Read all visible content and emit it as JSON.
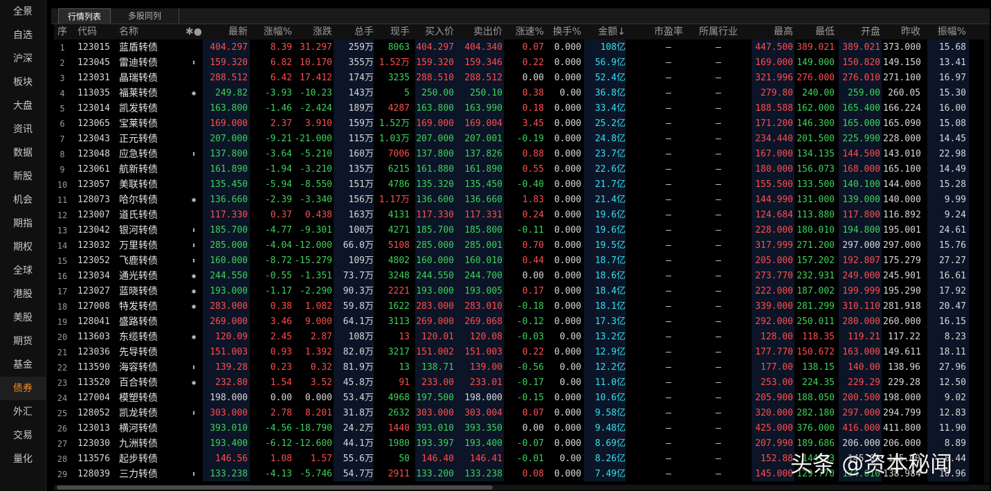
{
  "sidebar": [
    "全景",
    "自选",
    "沪深",
    "板块",
    "大盘",
    "资讯",
    "数据",
    "新股",
    "机会",
    "期指",
    "期权",
    "全球",
    "港股",
    "美股",
    "期货",
    "基金",
    "债券",
    "外汇",
    "交易",
    "量化"
  ],
  "active_sidebar": "债券",
  "tabs": [
    "行情列表",
    "多股同列"
  ],
  "columns": [
    "序",
    "代码",
    "名称",
    "✱●",
    "最新",
    "涨幅%",
    "涨跌",
    "总手",
    "现手",
    "买入价",
    "卖出价",
    "涨速%",
    "换手%",
    "金额↓",
    "市盈率",
    "所属行业",
    "最高",
    "最低",
    "开盘",
    "昨收",
    "振幅%"
  ],
  "colors": {
    "up": "#ff4d4d",
    "down": "#3cd35b",
    "flat": "#d8d8d8",
    "amount": "#33e0f0",
    "active_tab": "#ff8a1e"
  },
  "rows": [
    [
      "1",
      "123015",
      "蓝盾转债",
      "",
      "404.297",
      "8.39",
      "31.297",
      "259万",
      "8063",
      "404.297",
      "404.340",
      "0.07",
      "0.000",
      "108亿",
      "—",
      "—",
      "447.500",
      "389.021",
      "389.021",
      "373.000",
      "15.68"
    ],
    [
      "2",
      "123045",
      "雷迪转债",
      "⬍",
      "159.320",
      "6.82",
      "10.170",
      "355万",
      "1.52万",
      "159.320",
      "159.346",
      "0.22",
      "0.000",
      "56.9亿",
      "—",
      "—",
      "169.000",
      "149.000",
      "150.820",
      "149.150",
      "13.41"
    ],
    [
      "3",
      "123031",
      "晶瑞转债",
      "",
      "288.512",
      "6.42",
      "17.412",
      "174万",
      "3235",
      "288.510",
      "288.512",
      "0.00",
      "0.000",
      "52.4亿",
      "—",
      "—",
      "321.996",
      "276.000",
      "276.010",
      "271.100",
      "16.97"
    ],
    [
      "4",
      "113035",
      "福莱转债",
      "✱",
      "249.82",
      "-3.93",
      "-10.23",
      "143万",
      "5",
      "250.00",
      "250.10",
      "0.38",
      "0.00",
      "36.8亿",
      "—",
      "—",
      "279.80",
      "240.00",
      "259.00",
      "260.05",
      "15.30"
    ],
    [
      "5",
      "123014",
      "凯发转债",
      "",
      "163.800",
      "-1.46",
      "-2.424",
      "189万",
      "4287",
      "163.800",
      "163.990",
      "0.18",
      "0.000",
      "33.4亿",
      "—",
      "—",
      "188.588",
      "162.000",
      "165.400",
      "166.224",
      "16.00"
    ],
    [
      "6",
      "123065",
      "宝莱转债",
      "",
      "169.000",
      "2.37",
      "3.910",
      "159万",
      "1.52万",
      "169.000",
      "169.004",
      "3.45",
      "0.000",
      "25.2亿",
      "—",
      "—",
      "171.200",
      "146.300",
      "165.000",
      "165.090",
      "15.08"
    ],
    [
      "7",
      "123043",
      "正元转债",
      "",
      "207.000",
      "-9.21",
      "-21.000",
      "115万",
      "1.03万",
      "207.000",
      "207.001",
      "-0.19",
      "0.000",
      "24.8亿",
      "—",
      "—",
      "234.440",
      "201.500",
      "225.990",
      "228.000",
      "14.45"
    ],
    [
      "8",
      "123048",
      "应急转债",
      "⬍",
      "137.800",
      "-3.64",
      "-5.210",
      "160万",
      "7006",
      "137.800",
      "137.826",
      "0.88",
      "0.000",
      "23.7亿",
      "—",
      "—",
      "167.000",
      "134.135",
      "144.500",
      "143.010",
      "22.98"
    ],
    [
      "9",
      "123061",
      "航新转债",
      "",
      "161.890",
      "-1.94",
      "-3.210",
      "135万",
      "6215",
      "161.880",
      "161.890",
      "0.55",
      "0.000",
      "22.6亿",
      "—",
      "—",
      "180.000",
      "156.073",
      "168.000",
      "165.100",
      "14.49"
    ],
    [
      "10",
      "123057",
      "美联转债",
      "",
      "135.450",
      "-5.94",
      "-8.550",
      "151万",
      "4786",
      "135.320",
      "135.450",
      "-0.40",
      "0.000",
      "21.7亿",
      "—",
      "—",
      "155.500",
      "133.500",
      "140.100",
      "144.000",
      "15.28"
    ],
    [
      "11",
      "128073",
      "哈尔转债",
      "✱",
      "136.660",
      "-2.39",
      "-3.340",
      "156万",
      "1.17万",
      "136.600",
      "136.660",
      "1.83",
      "0.000",
      "21.4亿",
      "—",
      "—",
      "144.990",
      "131.000",
      "139.000",
      "140.000",
      "9.99"
    ],
    [
      "12",
      "123007",
      "道氏转债",
      "",
      "117.330",
      "0.37",
      "0.438",
      "163万",
      "4131",
      "117.330",
      "117.331",
      "0.24",
      "0.000",
      "19.6亿",
      "—",
      "—",
      "124.684",
      "113.880",
      "117.800",
      "116.892",
      "9.24"
    ],
    [
      "13",
      "123042",
      "银河转债",
      "⬍",
      "185.700",
      "-4.77",
      "-9.301",
      "100万",
      "4271",
      "185.700",
      "185.800",
      "-0.11",
      "0.000",
      "19.6亿",
      "—",
      "—",
      "228.000",
      "180.010",
      "194.800",
      "195.001",
      "24.61"
    ],
    [
      "14",
      "123032",
      "万里转债",
      "⬍",
      "285.000",
      "-4.04",
      "-12.000",
      "66.0万",
      "5108",
      "285.000",
      "285.001",
      "0.70",
      "0.000",
      "19.5亿",
      "—",
      "—",
      "317.999",
      "271.200",
      "297.000",
      "297.000",
      "15.76"
    ],
    [
      "15",
      "123052",
      "飞鹿转债",
      "⬍",
      "160.000",
      "-8.72",
      "-15.279",
      "109万",
      "4802",
      "160.000",
      "160.010",
      "0.44",
      "0.000",
      "18.7亿",
      "—",
      "—",
      "205.000",
      "157.202",
      "192.807",
      "175.279",
      "27.27"
    ],
    [
      "16",
      "123034",
      "通光转债",
      "✱",
      "244.550",
      "-0.55",
      "-1.351",
      "73.7万",
      "3248",
      "244.550",
      "244.700",
      "0.00",
      "0.000",
      "18.6亿",
      "—",
      "—",
      "273.770",
      "232.931",
      "249.000",
      "245.901",
      "16.61"
    ],
    [
      "17",
      "123027",
      "蓝晓转债",
      "✱",
      "193.000",
      "-1.17",
      "-2.290",
      "90.3万",
      "2221",
      "193.000",
      "193.005",
      "0.17",
      "0.000",
      "18.4亿",
      "—",
      "—",
      "222.000",
      "187.002",
      "199.999",
      "195.290",
      "17.92"
    ],
    [
      "18",
      "127008",
      "特发转债",
      "✱",
      "283.000",
      "0.38",
      "1.082",
      "59.8万",
      "1622",
      "283.000",
      "283.010",
      "-0.18",
      "0.000",
      "18.1亿",
      "—",
      "—",
      "339.000",
      "281.299",
      "310.110",
      "281.918",
      "20.47"
    ],
    [
      "19",
      "128041",
      "盛路转债",
      "",
      "269.000",
      "3.46",
      "9.000",
      "64.1万",
      "3113",
      "269.000",
      "269.068",
      "-0.12",
      "0.000",
      "17.3亿",
      "—",
      "—",
      "292.000",
      "250.011",
      "280.000",
      "260.000",
      "16.15"
    ],
    [
      "20",
      "113603",
      "东缆转债",
      "✱",
      "120.09",
      "2.45",
      "2.87",
      "108万",
      "13",
      "120.01",
      "120.08",
      "-0.03",
      "0.00",
      "13.2亿",
      "—",
      "—",
      "128.00",
      "118.35",
      "119.21",
      "117.22",
      "8.23"
    ],
    [
      "21",
      "123036",
      "先导转债",
      "",
      "151.003",
      "0.93",
      "1.392",
      "82.0万",
      "3217",
      "151.002",
      "151.003",
      "0.22",
      "0.000",
      "12.9亿",
      "—",
      "—",
      "177.770",
      "150.672",
      "163.000",
      "149.611",
      "18.11"
    ],
    [
      "22",
      "113590",
      "海容转债",
      "⬍",
      "139.28",
      "0.23",
      "0.32",
      "81.9万",
      "13",
      "138.71",
      "139.00",
      "-0.56",
      "0.00",
      "12.2亿",
      "—",
      "—",
      "177.00",
      "138.15",
      "140.00",
      "138.96",
      "27.96"
    ],
    [
      "23",
      "113520",
      "百合转债",
      "✱",
      "232.80",
      "1.54",
      "3.52",
      "45.8万",
      "91",
      "233.00",
      "233.01",
      "-0.17",
      "0.00",
      "11.0亿",
      "—",
      "—",
      "253.00",
      "224.35",
      "229.29",
      "229.28",
      "12.50"
    ],
    [
      "24",
      "127004",
      "模塑转债",
      "",
      "198.000",
      "0.00",
      "0.000",
      "53.4万",
      "4968",
      "197.500",
      "198.000",
      "-0.15",
      "0.000",
      "10.6亿",
      "—",
      "—",
      "205.900",
      "188.050",
      "200.500",
      "198.000",
      "9.02"
    ],
    [
      "25",
      "128052",
      "凯龙转债",
      "⬍",
      "303.000",
      "2.78",
      "8.201",
      "31.8万",
      "2632",
      "303.000",
      "303.004",
      "0.07",
      "0.000",
      "9.58亿",
      "—",
      "—",
      "320.000",
      "282.180",
      "297.000",
      "294.799",
      "12.83"
    ],
    [
      "26",
      "123013",
      "横河转债",
      "",
      "393.010",
      "-4.56",
      "-18.790",
      "24.2万",
      "1440",
      "393.010",
      "393.350",
      "0.00",
      "0.000",
      "9.48亿",
      "—",
      "—",
      "425.000",
      "376.000",
      "416.000",
      "411.800",
      "11.90"
    ],
    [
      "27",
      "123030",
      "九洲转债",
      "",
      "193.400",
      "-6.12",
      "-12.600",
      "44.1万",
      "1980",
      "193.397",
      "193.400",
      "-0.07",
      "0.000",
      "8.69亿",
      "—",
      "—",
      "207.990",
      "189.686",
      "206.000",
      "206.000",
      "8.89"
    ],
    [
      "28",
      "113576",
      "起步转债",
      "",
      "146.56",
      "1.08",
      "1.57",
      "55.6万",
      "50",
      "146.40",
      "146.41",
      "-0.01",
      "0.00",
      "8.26亿",
      "—",
      "—",
      "152.88",
      "144.83",
      "145.00",
      "145.00",
      "5.44"
    ],
    [
      "29",
      "128039",
      "三力转债",
      "⬍",
      "133.238",
      "-4.13",
      "-5.746",
      "54.7万",
      "2911",
      "133.200",
      "133.238",
      "0.08",
      "0.000",
      "7.49亿",
      "—",
      "—",
      "145.000",
      "129.770",
      "134.010",
      "138.984",
      "10.96"
    ]
  ],
  "watermark": "头条 @资本秘闻"
}
